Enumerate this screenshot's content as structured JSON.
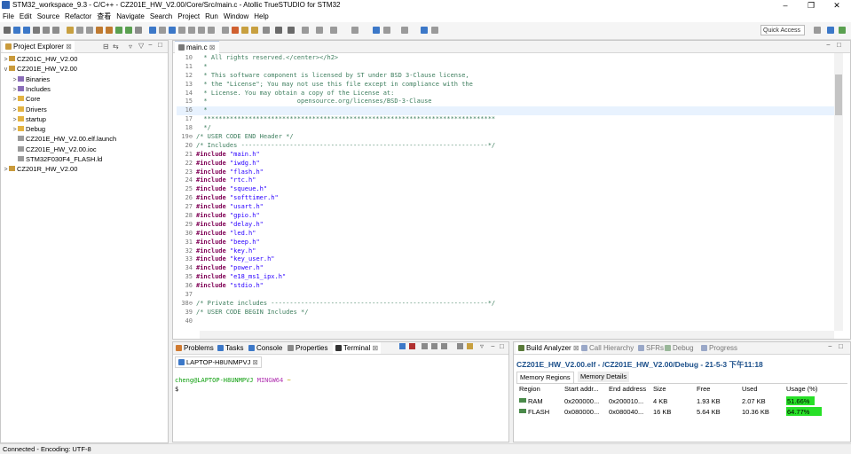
{
  "window": {
    "title": "STM32_workspace_9.3 - C/C++ - CZ201E_HW_V2.00/Core/Src/main.c - Atollic TrueSTUDIO for STM32",
    "minimize": "–",
    "maximize": "❐",
    "close": "✕"
  },
  "menu": [
    "File",
    "Edit",
    "Source",
    "Refactor",
    "查看",
    "Navigate",
    "Search",
    "Project",
    "Run",
    "Window",
    "Help"
  ],
  "toolbar": {
    "quick_access": "Quick Access"
  },
  "project_explorer": {
    "tab": "Project Explorer",
    "items": [
      {
        "label": "CZ201C_HW_V2.00",
        "twisty": ">",
        "icon": "project",
        "color": "#c99a3b"
      },
      {
        "label": "CZ201E_HW_V2.00",
        "twisty": "v",
        "icon": "project",
        "color": "#c99a3b"
      },
      {
        "label": "Binaries",
        "twisty": ">",
        "icon": "folder",
        "color": "#8a6db8"
      },
      {
        "label": "Includes",
        "twisty": ">",
        "icon": "folder",
        "color": "#8a6db8"
      },
      {
        "label": "Core",
        "twisty": ">",
        "icon": "folder",
        "color": "#e3b341"
      },
      {
        "label": "Drivers",
        "twisty": ">",
        "icon": "folder",
        "color": "#e3b341"
      },
      {
        "label": "startup",
        "twisty": ">",
        "icon": "folder",
        "color": "#e3b341"
      },
      {
        "label": "Debug",
        "twisty": ">",
        "icon": "folder",
        "color": "#e3b341"
      },
      {
        "label": "CZ201E_HW_V2.00.elf.launch",
        "twisty": "",
        "icon": "file",
        "color": "#9a9a9a"
      },
      {
        "label": "CZ201E_HW_V2.00.ioc",
        "twisty": "",
        "icon": "file",
        "color": "#9a9a9a"
      },
      {
        "label": "STM32F030F4_FLASH.ld",
        "twisty": "",
        "icon": "file",
        "color": "#9a9a9a"
      },
      {
        "label": "CZ201R_HW_V2.00",
        "twisty": ">",
        "icon": "project",
        "color": "#c99a3b"
      }
    ]
  },
  "editor": {
    "tab": "main.c",
    "lines": [
      {
        "n": "10",
        "t": "  * All rights reserved.</center></h2>",
        "c": "cmt"
      },
      {
        "n": "11",
        "t": "  *",
        "c": "cmt"
      },
      {
        "n": "12",
        "t": "  * This software component is licensed by ST under BSD 3-Clause license,",
        "c": "cmt"
      },
      {
        "n": "13",
        "t": "  * the \"License\"; You may not use this file except in compliance with the",
        "c": "cmt"
      },
      {
        "n": "14",
        "t": "  * License. You may obtain a copy of the License at:",
        "c": "cmt"
      },
      {
        "n": "15",
        "t": "  *                        opensource.org/licenses/BSD-3-Clause",
        "c": "cmt"
      },
      {
        "n": "16",
        "t": "  *",
        "c": "cmt hl"
      },
      {
        "n": "17",
        "t": "  ******************************************************************************",
        "c": "cmt"
      },
      {
        "n": "18",
        "t": "  */",
        "c": "cmt"
      },
      {
        "n": "19⊖",
        "t": "/* USER CODE END Header */",
        "c": "cmt"
      },
      {
        "n": "20",
        "t": "/* Includes ------------------------------------------------------------------*/",
        "c": "cmt"
      },
      {
        "n": "21",
        "t": "#include \"main.h\"",
        "c": "inc"
      },
      {
        "n": "22",
        "t": "#include \"iwdg.h\"",
        "c": "inc"
      },
      {
        "n": "23",
        "t": "#include \"flash.h\"",
        "c": "inc"
      },
      {
        "n": "24",
        "t": "#include \"rtc.h\"",
        "c": "inc"
      },
      {
        "n": "25",
        "t": "#include \"squeue.h\"",
        "c": "inc"
      },
      {
        "n": "26",
        "t": "#include \"softtimer.h\"",
        "c": "inc"
      },
      {
        "n": "27",
        "t": "#include \"usart.h\"",
        "c": "inc"
      },
      {
        "n": "28",
        "t": "#include \"gpio.h\"",
        "c": "inc"
      },
      {
        "n": "29",
        "t": "#include \"delay.h\"",
        "c": "inc"
      },
      {
        "n": "30",
        "t": "#include \"led.h\"",
        "c": "inc"
      },
      {
        "n": "31",
        "t": "#include \"beep.h\"",
        "c": "inc"
      },
      {
        "n": "32",
        "t": "#include \"key.h\"",
        "c": "inc"
      },
      {
        "n": "33",
        "t": "#include \"key_user.h\"",
        "c": "inc"
      },
      {
        "n": "34",
        "t": "#include \"power.h\"",
        "c": "inc"
      },
      {
        "n": "35",
        "t": "#include \"e18_ms1_ipx.h\"",
        "c": "inc"
      },
      {
        "n": "36",
        "t": "#include \"stdio.h\"",
        "c": "inc"
      },
      {
        "n": "37",
        "t": "",
        "c": ""
      },
      {
        "n": "38⊖",
        "t": "/* Private includes ----------------------------------------------------------*/",
        "c": "cmt"
      },
      {
        "n": "39",
        "t": "/* USER CODE BEGIN Includes */",
        "c": "cmt"
      },
      {
        "n": "40",
        "t": "",
        "c": ""
      }
    ]
  },
  "bottom_tabs": {
    "problems": "Problems",
    "tasks": "Tasks",
    "console": "Console",
    "properties": "Properties",
    "terminal": "Terminal"
  },
  "terminal": {
    "session": "LAPTOP-H8UNMPVJ",
    "prompt_user": "cheng@LAPTOP-H8UNMPVJ",
    "prompt_env": "MINGW64",
    "prompt_path": "~",
    "prompt_symbol": "$"
  },
  "build_tabs": {
    "build_analyzer": "Build Analyzer",
    "call_hierarchy": "Call Hierarchy",
    "sfrs": "SFRs",
    "debug": "Debug",
    "progress": "Progress"
  },
  "build_analyzer": {
    "heading": "CZ201E_HW_V2.00.elf - /CZ201E_HW_V2.00/Debug - 21-5-3 下午11:18",
    "tabs": [
      "Memory Regions",
      "Memory Details"
    ],
    "columns": [
      "Region",
      "Start addr...",
      "End address",
      "Size",
      "Free",
      "Used",
      "Usage (%)"
    ],
    "rows": [
      {
        "region": "RAM",
        "start": "0x200000...",
        "end": "0x200010...",
        "size": "4 KB",
        "free": "1.93 KB",
        "used": "2.07 KB",
        "usage": "51.66%",
        "usage_value": 51.66
      },
      {
        "region": "FLASH",
        "start": "0x080000...",
        "end": "0x080040...",
        "size": "16 KB",
        "free": "5.64 KB",
        "used": "10.36 KB",
        "usage": "64.77%",
        "usage_value": 64.77
      }
    ],
    "usage_color": "#27e027"
  },
  "status": {
    "text": "Connected - Encoding: UTF-8"
  }
}
